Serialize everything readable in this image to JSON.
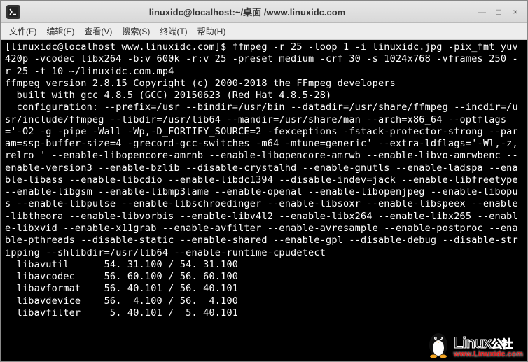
{
  "window": {
    "title": "linuxidc@localhost:~/桌面 /www.linuxidc.com"
  },
  "window_controls": {
    "minimize": "—",
    "maximize": "□",
    "close": "×"
  },
  "menu": {
    "file": "文件(F)",
    "edit": "编辑(E)",
    "view": "查看(V)",
    "search": "搜索(S)",
    "terminal": "终端(T)",
    "help": "帮助(H)"
  },
  "terminal": {
    "prompt_user": "[linuxidc@localhost www.linuxidc.com]$",
    "command": " ffmpeg -r 25 -loop 1 -i linuxidc.jpg -pix_fmt yuv420p -vcodec libx264 -b:v 600k -r:v 25 -preset medium -crf 30 -s 1024x768 -vframes 250 -r 25 -t 10 ~/linuxidc.com.mp4",
    "out1": "ffmpeg version 2.8.15 Copyright (c) 2000-2018 the FFmpeg developers",
    "out2": "  built with gcc 4.8.5 (GCC) 20150623 (Red Hat 4.8.5-28)",
    "out3": "  configuration: --prefix=/usr --bindir=/usr/bin --datadir=/usr/share/ffmpeg --incdir=/usr/include/ffmpeg --libdir=/usr/lib64 --mandir=/usr/share/man --arch=x86_64 --optflags='-O2 -g -pipe -Wall -Wp,-D_FORTIFY_SOURCE=2 -fexceptions -fstack-protector-strong --param=ssp-buffer-size=4 -grecord-gcc-switches -m64 -mtune=generic' --extra-ldflags='-Wl,-z,relro ' --enable-libopencore-amrnb --enable-libopencore-amrwb --enable-libvo-amrwbenc --enable-version3 --enable-bzlib --disable-crystalhd --enable-gnutls --enable-ladspa --enable-libass --enable-libcdio --enable-libdc1394 --disable-indev=jack --enable-libfreetype --enable-libgsm --enable-libmp3lame --enable-openal --enable-libopenjpeg --enable-libopus --enable-libpulse --enable-libschroedinger --enable-libsoxr --enable-libspeex --enable-libtheora --enable-libvorbis --enable-libv4l2 --enable-libx264 --enable-libx265 --enable-libxvid --enable-x11grab --enable-avfilter --enable-avresample --enable-postproc --enable-pthreads --disable-static --enable-shared --enable-gpl --disable-debug --disable-stripping --shlibdir=/usr/lib64 --enable-runtime-cpudetect",
    "lib1": "  libavutil      54. 31.100 / 54. 31.100",
    "lib2": "  libavcodec     56. 60.100 / 56. 60.100",
    "lib3": "  libavformat    56. 40.101 / 56. 40.101",
    "lib4": "  libavdevice    56.  4.100 / 56.  4.100",
    "lib5": "  libavfilter     5. 40.101 /  5. 40.101"
  },
  "watermark": {
    "brand": "Linux",
    "brand_suffix": "公社",
    "url": "www.Linuxidc.com"
  }
}
